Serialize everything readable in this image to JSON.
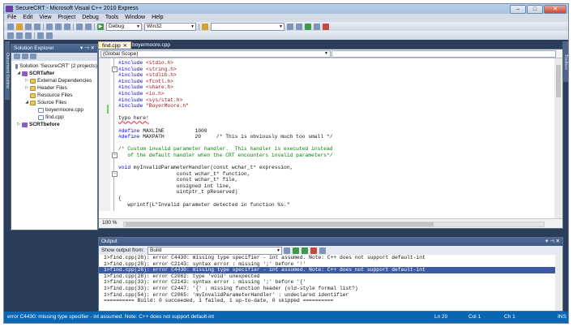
{
  "window": {
    "title": "SecureCRT - Microsoft Visual C++ 2010 Express"
  },
  "menu": [
    "File",
    "Edit",
    "View",
    "Project",
    "Debug",
    "Tools",
    "Window",
    "Help"
  ],
  "toolbar": {
    "config": "Debug",
    "platform": "Win32"
  },
  "solution_explorer": {
    "title": "Solution Explorer",
    "items": [
      {
        "label": "Solution 'SecureCRT' (2 projects)",
        "bold": false
      },
      {
        "label": "SCRTafter",
        "bold": true
      },
      {
        "label": "External Dependencies",
        "bold": false
      },
      {
        "label": "Header Files",
        "bold": false
      },
      {
        "label": "Resource Files",
        "bold": false
      },
      {
        "label": "Source Files",
        "bold": false
      },
      {
        "label": "boyermoore.cpp",
        "bold": false
      },
      {
        "label": "find.cpp",
        "bold": false
      },
      {
        "label": "SCRTbefore",
        "bold": true
      }
    ]
  },
  "side_tabs": {
    "left": "Document Outline",
    "right": "Toolbox"
  },
  "tabs": [
    {
      "label": "find.cpp",
      "active": true
    },
    {
      "label": "boyermoore.cpp",
      "active": false
    }
  ],
  "editor": {
    "scope": "(Global Scope)",
    "zoom": "100 %",
    "lines": [
      "#include <stdio.h>",
      "#include <string.h>",
      "#include <stdlib.h>",
      "#include <fcntl.h>",
      "#include <share.h>",
      "#include <io.h>",
      "#include <sys/stat.h>",
      "#include \"BoyerMoore.h\"",
      "",
      "typo here!",
      "",
      "#define MAXLINE          1000",
      "#define MAXPATH          20     /* This is obviously much too small */",
      "",
      "/* Custom invalid parameter handler.  This handler is executed instead",
      "   of the default handler when the CRT encounters invalid parameters*/",
      "",
      "void myInvalidParameterHandler(const wchar_t* expression,",
      "                   const wchar_t* function,",
      "                   const wchar_t* file,",
      "                   unsigned int line,",
      "                   uintptr_t pReserved)",
      "{",
      "   wprintf(L\"Invalid parameter detected in function %s.\""
    ]
  },
  "output": {
    "title": "Output",
    "show_label": "Show output from:",
    "source": "Build",
    "lines": [
      "1>find.cpp(28): error C4430: missing type specifier - int assumed. Note: C++ does not support default-int",
      "1>find.cpp(28): error C2143: syntax error : missing ';' before '!'",
      "1>find.cpp(28): error C4430: missing type specifier - int assumed. Note: C++ does not support default-int",
      "1>find.cpp(28): error C2062: type 'void' unexpected",
      "1>find.cpp(33): error C2143: syntax error : missing ';' before '{'",
      "1>find.cpp(33): error C2447: '{' : missing function header (old-style formal list?)",
      "1>find.cpp(54): error C2065: 'myInvalidParameterHandler' : undeclared identifier",
      "========== Build: 0 succeeded, 1 failed, 1 up-to-date, 0 skipped =========="
    ],
    "selected_index": 2
  },
  "status": {
    "message": "error C4430: missing type specifier - int assumed. Note: C++ does not support default-int",
    "ln": "Ln 20",
    "col": "Col 1",
    "ch": "Ch 1",
    "mode": "INS"
  },
  "colors": {
    "accent": "#0a66b3",
    "selection": "#3b5ba7",
    "chrome": "#2c3d5a",
    "active_tab": "#fef6c9"
  }
}
